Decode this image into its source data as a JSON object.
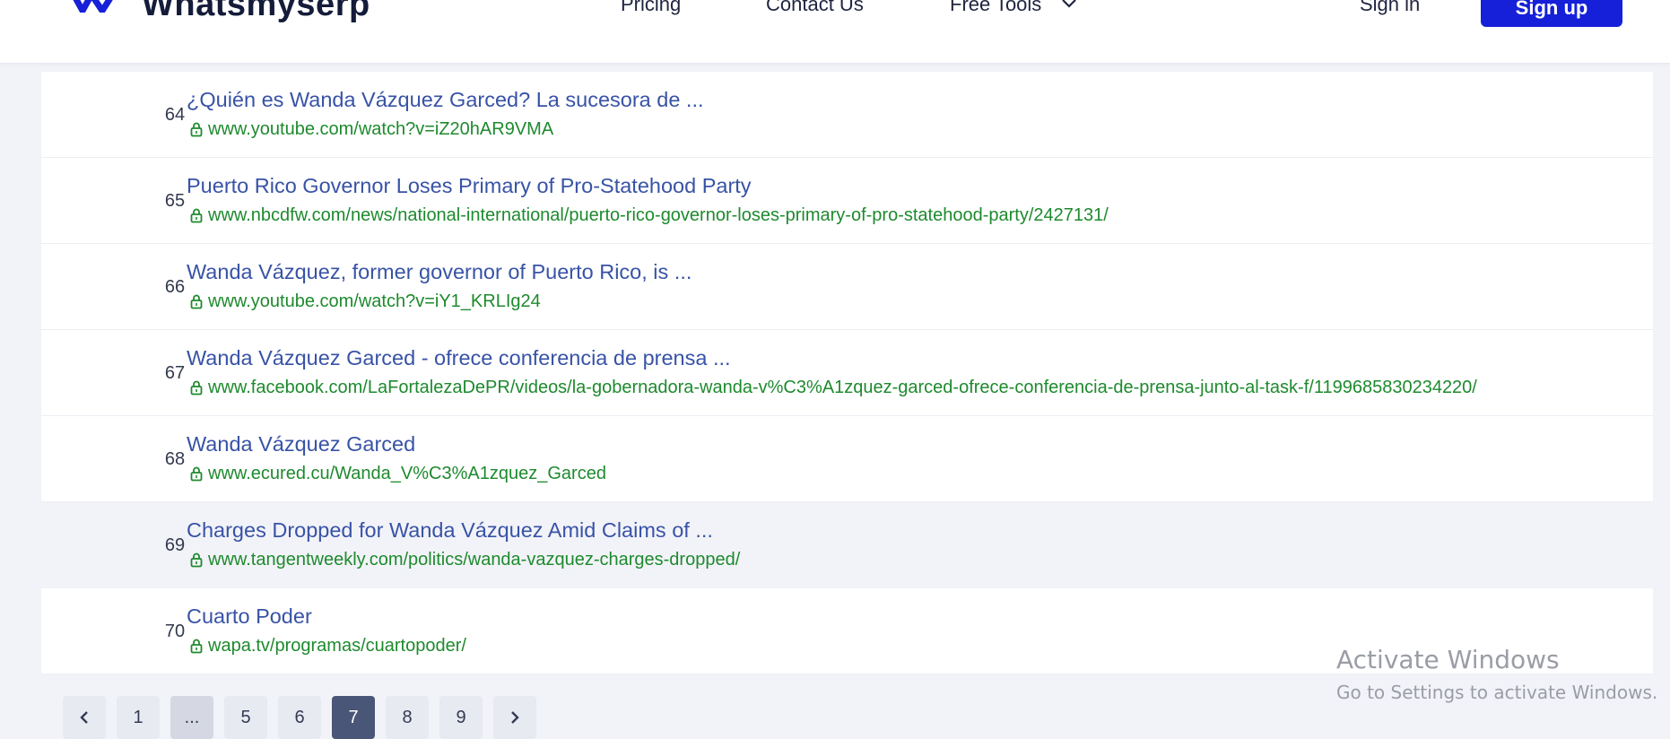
{
  "header": {
    "logo_text": "Whatsmyserp",
    "nav": {
      "pricing": "Pricing",
      "contact": "Contact Us",
      "free_tools": "Free Tools"
    },
    "signin": "Sign in",
    "signup": "Sign up"
  },
  "results": [
    {
      "rank": "64",
      "title": "¿Quién es Wanda Vázquez Garced? La sucesora de ...",
      "url": "www.youtube.com/watch?v=iZ20hAR9VMA"
    },
    {
      "rank": "65",
      "title": "Puerto Rico Governor Loses Primary of Pro-Statehood Party",
      "url": "www.nbcdfw.com/news/national-international/puerto-rico-governor-loses-primary-of-pro-statehood-party/2427131/"
    },
    {
      "rank": "66",
      "title": "Wanda Vázquez, former governor of Puerto Rico, is ...",
      "url": "www.youtube.com/watch?v=iY1_KRLIg24"
    },
    {
      "rank": "67",
      "title": "Wanda Vázquez Garced - ofrece conferencia de prensa ...",
      "url": "www.facebook.com/LaFortalezaDePR/videos/la-gobernadora-wanda-v%C3%A1zquez-garced-ofrece-conferencia-de-prensa-junto-al-task-f/1199685830234220/"
    },
    {
      "rank": "68",
      "title": "Wanda Vázquez Garced",
      "url": "www.ecured.cu/Wanda_V%C3%A1zquez_Garced"
    },
    {
      "rank": "69",
      "title": "Charges Dropped for Wanda Vázquez Amid Claims of ...",
      "url": "www.tangentweekly.com/politics/wanda-vazquez-charges-dropped/"
    },
    {
      "rank": "70",
      "title": "Cuarto Poder",
      "url": "wapa.tv/programas/cuartopoder/"
    }
  ],
  "pagination": {
    "prev_icon": "chevron-left-icon",
    "next_icon": "chevron-right-icon",
    "pages": [
      "1",
      "...",
      "5",
      "6",
      "7",
      "8",
      "9"
    ],
    "current": "7"
  },
  "watermark": {
    "title": "Activate Windows",
    "subtitle": "Go to Settings to activate Windows."
  },
  "colors": {
    "brand": "#1620d8",
    "title_link": "#3853a6",
    "url_green": "#1e8a2e",
    "pager_active": "#4a5677"
  }
}
